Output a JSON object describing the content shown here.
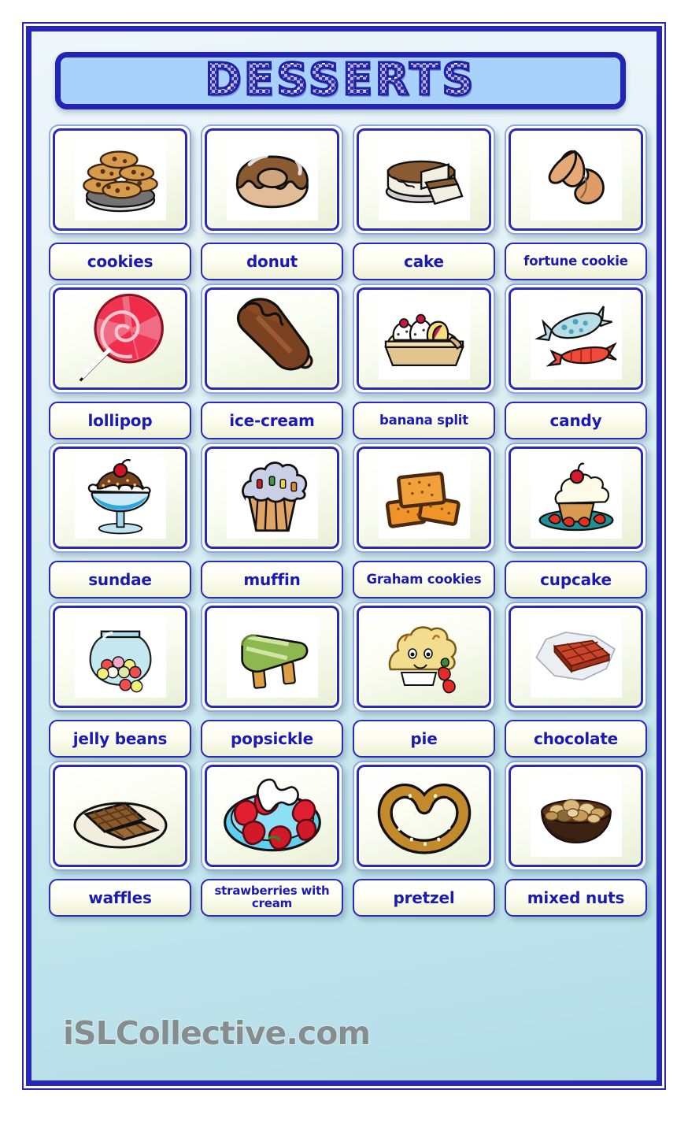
{
  "poster": {
    "title": "DESSERTS",
    "watermark": "iSLCollective.com",
    "accent_border": "#2626b8",
    "label_text_color": "#1b1bb0",
    "banner_fill": "#a8d2fb",
    "background": "light blue-to-teal vertical gradient"
  },
  "rows": [
    {
      "cells": [
        {
          "label": "cookies",
          "icon": "cookies-clipart",
          "art_style": "framed",
          "label_size": "md"
        },
        {
          "label": "donut",
          "icon": "donut-clipart",
          "art_style": "framed",
          "label_size": "md"
        },
        {
          "label": "cake",
          "icon": "cake-clipart",
          "art_style": "framed",
          "label_size": "md"
        },
        {
          "label": "fortune cookie",
          "icon": "fortune-cookie-clipart",
          "art_style": "framed",
          "label_size": "sm"
        }
      ]
    },
    {
      "cells": [
        {
          "label": "lollipop",
          "icon": "lollipop-clipart",
          "art_style": "full",
          "label_size": "md"
        },
        {
          "label": "ice-cream",
          "icon": "ice-cream-bar-clipart",
          "art_style": "full",
          "label_size": "md"
        },
        {
          "label": "banana split",
          "icon": "banana-split-clipart",
          "art_style": "framed",
          "label_size": "sm"
        },
        {
          "label": "candy",
          "icon": "candy-clipart",
          "art_style": "framed",
          "label_size": "md"
        }
      ]
    },
    {
      "cells": [
        {
          "label": "sundae",
          "icon": "sundae-clipart",
          "art_style": "framed",
          "label_size": "md"
        },
        {
          "label": "muffin",
          "icon": "muffin-clipart",
          "art_style": "framed",
          "label_size": "md"
        },
        {
          "label": "Graham cookies",
          "icon": "graham-cookies-clipart",
          "art_style": "framed",
          "label_size": "sm"
        },
        {
          "label": "cupcake",
          "icon": "cupcake-clipart",
          "art_style": "framed",
          "label_size": "md"
        }
      ]
    },
    {
      "cells": [
        {
          "label": "jelly beans",
          "icon": "jelly-beans-jar-clipart",
          "art_style": "framed",
          "label_size": "md"
        },
        {
          "label": "popsickle",
          "icon": "popsicle-clipart",
          "art_style": "framed",
          "label_size": "md"
        },
        {
          "label": "pie",
          "icon": "pie-clipart",
          "art_style": "full",
          "label_size": "md"
        },
        {
          "label": "chocolate",
          "icon": "chocolate-bar-clipart",
          "art_style": "framed",
          "label_size": "md"
        }
      ]
    },
    {
      "cells": [
        {
          "label": "waffles",
          "icon": "waffles-clipart",
          "art_style": "full",
          "label_size": "md"
        },
        {
          "label": "strawberries with cream",
          "icon": "strawberries-cream-clipart",
          "art_style": "full",
          "label_size": "xs"
        },
        {
          "label": "pretzel",
          "icon": "pretzel-clipart",
          "art_style": "full",
          "label_size": "md"
        },
        {
          "label": "mixed nuts",
          "icon": "mixed-nuts-bowl-clipart",
          "art_style": "framed",
          "label_size": "md"
        }
      ]
    }
  ]
}
